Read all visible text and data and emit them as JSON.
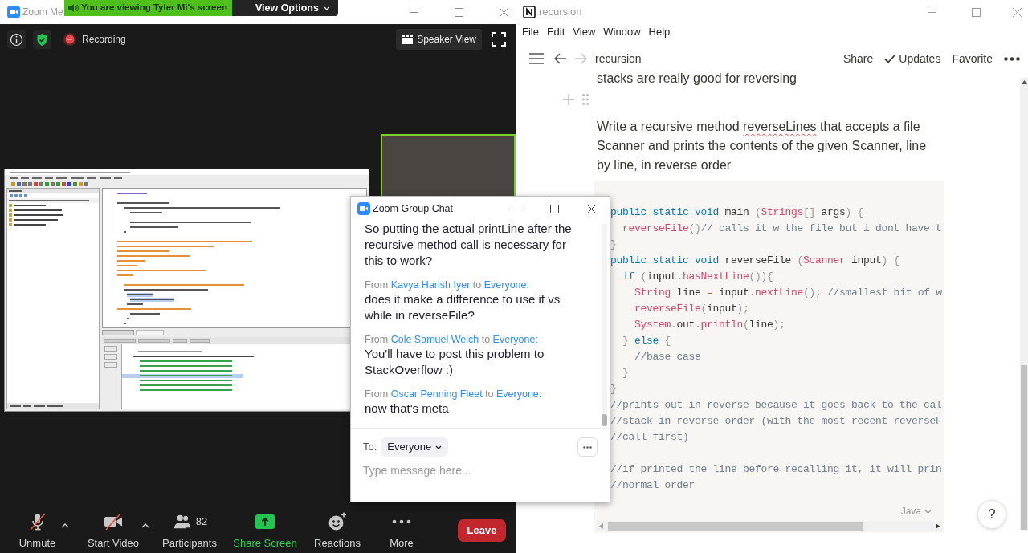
{
  "zoom": {
    "title": "Zoom Me",
    "banner": {
      "message": "You are viewing Tyler Mi's screen",
      "options": "View Options"
    },
    "top_bar": {
      "recording": "Recording",
      "view_button": "Speaker View"
    },
    "toolbar": [
      {
        "kind": "microphone",
        "label": "Unmute",
        "off": true,
        "menu": true
      },
      {
        "kind": "video",
        "label": "Start Video",
        "off": true,
        "menu": true
      },
      {
        "kind": "participants",
        "label": "Participants",
        "count": "82",
        "off": false,
        "menu": false
      },
      {
        "kind": "share",
        "label": "Share Screen",
        "off": false,
        "menu": false
      },
      {
        "kind": "reactions",
        "label": "Reactions",
        "off": false,
        "menu": false
      },
      {
        "kind": "more",
        "label": "More",
        "off": false,
        "menu": false
      }
    ],
    "leave_button": "Leave"
  },
  "chat": {
    "title": "Zoom Group Chat",
    "messages": [
      {
        "text": "So putting the actual printLine after the recursive method call is necessary for this to work?"
      },
      {
        "from": "From",
        "sender": "Kavya Harish Iyer",
        "to": "to",
        "recipient": "Everyone:",
        "text": "does it make a difference to use if vs while in reverseFile?"
      },
      {
        "from": "From",
        "sender": "Cole Samuel Welch",
        "to": "to",
        "recipient": "Everyone:",
        "text": "You'll have to post this problem to StackOverflow :)"
      },
      {
        "from": "From",
        "sender": "Oscar Penning Fleet",
        "to": "to",
        "recipient": "Everyone:",
        "text": "now that's meta"
      }
    ],
    "to_label": "To:",
    "recipient_select": "Everyone",
    "input": {
      "placeholder": "Type message here..."
    }
  },
  "notion": {
    "title": "recursion",
    "menu": [
      "File",
      "Edit",
      "View",
      "Window",
      "Help"
    ],
    "navigation": [
      {
        "kind": "back",
        "disabled": false
      },
      {
        "kind": "forward",
        "disabled": true
      }
    ],
    "breadcrumb": "recursion",
    "actions": [
      {
        "kind": "text",
        "label": "Share"
      },
      {
        "kind": "check",
        "label": "Updates"
      },
      {
        "kind": "text",
        "label": "Favorite"
      }
    ],
    "previous_line": "stacks are really good for reversing",
    "paragraph": [
      {
        "text": "Write a recursive method ",
        "misspelled": false
      },
      {
        "text": "reverseLines",
        "misspelled": true
      },
      {
        "text": " that accepts a file Scanner and prints the contents of the given Scanner, line by line, in reverse order",
        "misspelled": false
      }
    ],
    "code": {
      "lines": [
        {
          "kind": "code",
          "tokens": [
            {
              "text": "public static void",
              "kind": "keyword"
            },
            {
              "text": " main ",
              "kind": "plain"
            },
            {
              "text": "(",
              "kind": "punct"
            },
            {
              "text": "Strings",
              "kind": "name"
            },
            {
              "text": "[]",
              "kind": "punct"
            },
            {
              "text": " args",
              "kind": "plain"
            },
            {
              "text": ") {",
              "kind": "punct"
            }
          ]
        },
        {
          "kind": "code",
          "tokens": [
            {
              "text": "  reverseFile",
              "kind": "name"
            },
            {
              "text": "()",
              "kind": "punct"
            },
            {
              "text": "// calls it w the file but i dont have t",
              "kind": "comment"
            }
          ]
        },
        {
          "kind": "code",
          "tokens": [
            {
              "text": "}",
              "kind": "punct"
            }
          ]
        },
        {
          "kind": "code",
          "tokens": [
            {
              "text": "public static void",
              "kind": "keyword"
            },
            {
              "text": " reverseFile ",
              "kind": "plain"
            },
            {
              "text": "(",
              "kind": "punct"
            },
            {
              "text": "Scanner",
              "kind": "name"
            },
            {
              "text": " input",
              "kind": "plain"
            },
            {
              "text": ") {",
              "kind": "punct"
            }
          ]
        },
        {
          "kind": "code",
          "tokens": [
            {
              "text": "  if",
              "kind": "keyword"
            },
            {
              "text": " (",
              "kind": "punct"
            },
            {
              "text": "input",
              "kind": "plain"
            },
            {
              "text": ".",
              "kind": "punct"
            },
            {
              "text": "hasNextLine",
              "kind": "name"
            },
            {
              "text": "()){",
              "kind": "punct"
            }
          ]
        },
        {
          "kind": "code",
          "tokens": [
            {
              "text": "    String",
              "kind": "name"
            },
            {
              "text": " line ",
              "kind": "plain"
            },
            {
              "text": "=",
              "kind": "operator"
            },
            {
              "text": " input",
              "kind": "plain"
            },
            {
              "text": ".",
              "kind": "punct"
            },
            {
              "text": "nextLine",
              "kind": "name"
            },
            {
              "text": "();",
              "kind": "punct"
            },
            {
              "text": " //smallest bit of w",
              "kind": "comment"
            }
          ]
        },
        {
          "kind": "code",
          "tokens": [
            {
              "text": "    reverseFile",
              "kind": "name"
            },
            {
              "text": "(",
              "kind": "punct"
            },
            {
              "text": "input",
              "kind": "plain"
            },
            {
              "text": ");",
              "kind": "punct"
            }
          ]
        },
        {
          "kind": "code",
          "tokens": [
            {
              "text": "    System",
              "kind": "name"
            },
            {
              "text": ".",
              "kind": "punct"
            },
            {
              "text": "out",
              "kind": "plain"
            },
            {
              "text": ".",
              "kind": "punct"
            },
            {
              "text": "println",
              "kind": "name"
            },
            {
              "text": "(",
              "kind": "punct"
            },
            {
              "text": "line",
              "kind": "plain"
            },
            {
              "text": ");",
              "kind": "punct"
            }
          ]
        },
        {
          "kind": "code",
          "tokens": [
            {
              "text": "  }",
              "kind": "punct"
            },
            {
              "text": " else",
              "kind": "keyword"
            },
            {
              "text": " {",
              "kind": "punct"
            }
          ]
        },
        {
          "kind": "code",
          "tokens": [
            {
              "text": "    //base case",
              "kind": "comment"
            }
          ]
        },
        {
          "kind": "code",
          "tokens": [
            {
              "text": "  }",
              "kind": "punct"
            }
          ]
        },
        {
          "kind": "code",
          "tokens": [
            {
              "text": "}",
              "kind": "punct"
            }
          ]
        },
        {
          "kind": "code",
          "tokens": [
            {
              "text": "//prints out in reverse because it goes back to the cal",
              "kind": "comment"
            }
          ]
        },
        {
          "kind": "code",
          "tokens": [
            {
              "text": "//stack in reverse order (with the most recent reverseF",
              "kind": "comment"
            }
          ]
        },
        {
          "kind": "code",
          "tokens": [
            {
              "text": "//call first)",
              "kind": "comment"
            }
          ]
        },
        {
          "kind": "blank"
        },
        {
          "kind": "code",
          "tokens": [
            {
              "text": "//if printed the line before recalling it, it will prin",
              "kind": "comment"
            }
          ]
        },
        {
          "kind": "code",
          "tokens": [
            {
              "text": "//normal order",
              "kind": "comment"
            }
          ]
        }
      ],
      "language": "Java"
    },
    "help_button": "?"
  }
}
